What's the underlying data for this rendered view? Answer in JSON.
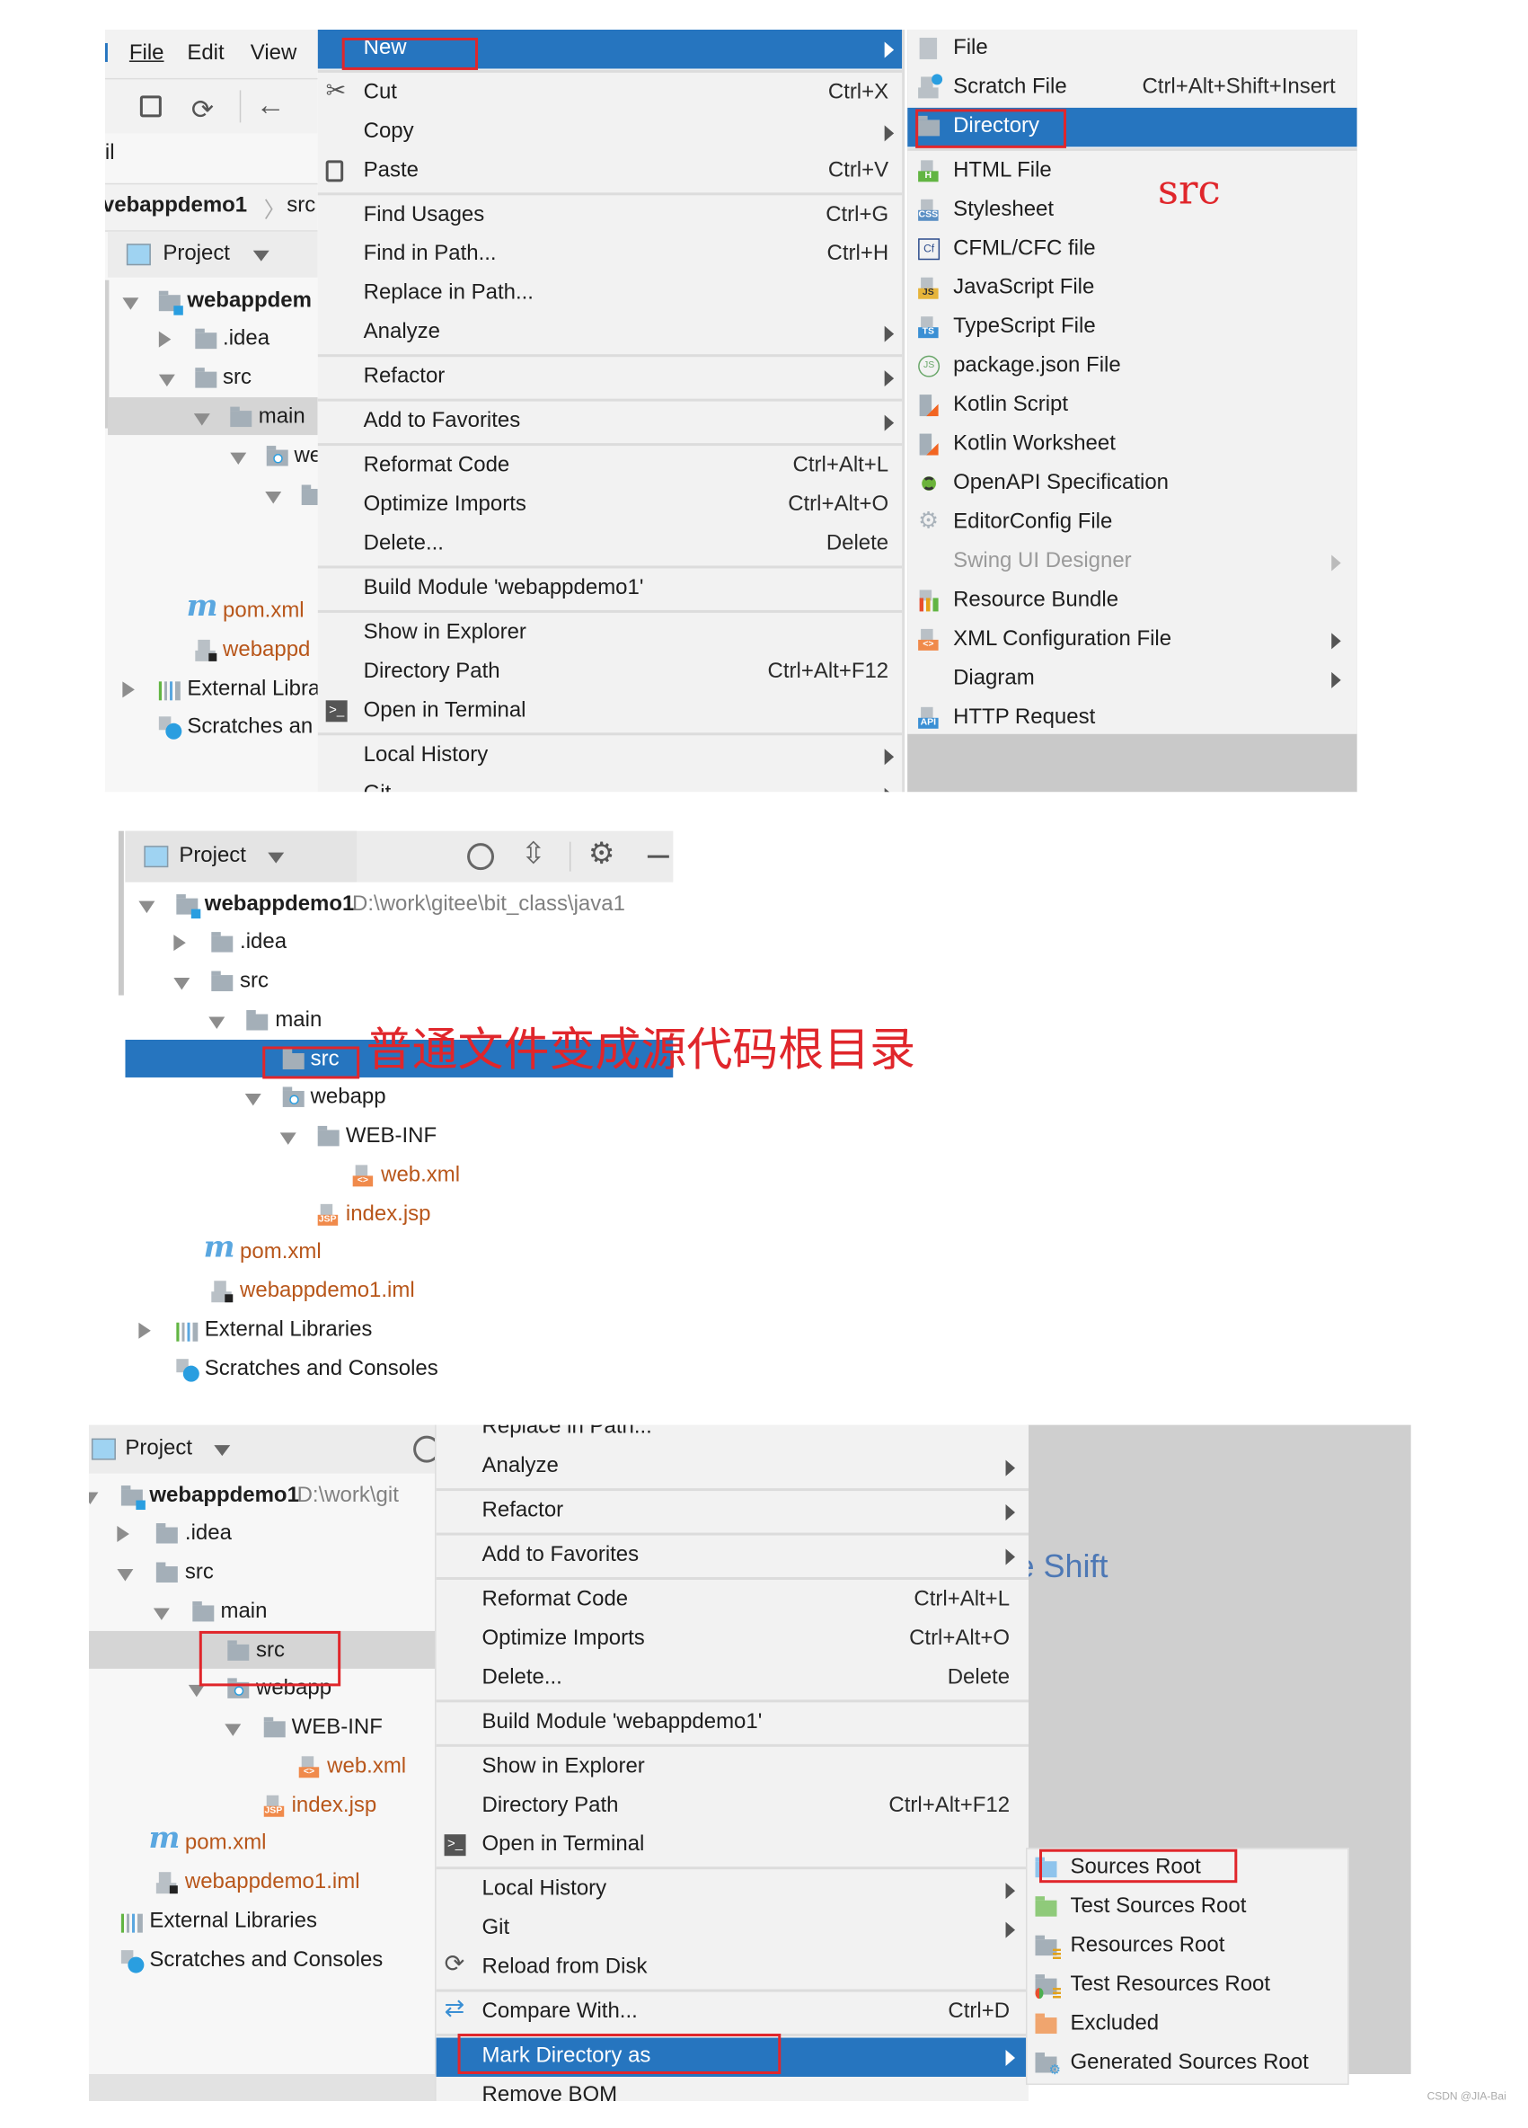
{
  "panel1": {
    "menu_bar": [
      "File",
      "Edit",
      "View"
    ],
    "toolbar_fragment": "il",
    "breadcrumb": [
      "vebappdemo1",
      "src"
    ],
    "project_label": "Project",
    "tree": [
      {
        "label": "webappdem",
        "icon": "module",
        "toggle": "exp",
        "bold": true
      },
      {
        "label": ".idea",
        "icon": "folder",
        "toggle": "col"
      },
      {
        "label": "src",
        "icon": "folder",
        "toggle": "exp"
      },
      {
        "label": "main",
        "icon": "folder",
        "toggle": "exp",
        "selected": true
      },
      {
        "label": "we",
        "icon": "web-folder",
        "toggle": "exp"
      },
      {
        "label": "",
        "icon": "folder",
        "toggle": "exp"
      },
      {
        "label": "",
        "icon": "none"
      },
      {
        "label": "",
        "icon": "jsp"
      },
      {
        "label": "pom.xml",
        "icon": "maven",
        "color": "#b8561a"
      },
      {
        "label": "webappd",
        "icon": "iml",
        "color": "#b8561a"
      },
      {
        "label": "External Libra",
        "icon": "libraries",
        "toggle": "col"
      },
      {
        "label": "Scratches an",
        "icon": "scratches"
      }
    ],
    "context_menu": [
      {
        "label": "New",
        "submenu": true,
        "highlighted": true
      },
      {
        "separator": true
      },
      {
        "label": "Cut",
        "shortcut": "Ctrl+X",
        "icon": "cut"
      },
      {
        "label": "Copy",
        "submenu": true
      },
      {
        "label": "Paste",
        "shortcut": "Ctrl+V",
        "icon": "paste"
      },
      {
        "separator": true
      },
      {
        "label": "Find Usages",
        "shortcut": "Ctrl+G"
      },
      {
        "label": "Find in Path...",
        "shortcut": "Ctrl+H"
      },
      {
        "label": "Replace in Path..."
      },
      {
        "label": "Analyze",
        "submenu": true
      },
      {
        "separator": true
      },
      {
        "label": "Refactor",
        "submenu": true
      },
      {
        "separator": true
      },
      {
        "label": "Add to Favorites",
        "submenu": true
      },
      {
        "separator": true
      },
      {
        "label": "Reformat Code",
        "shortcut": "Ctrl+Alt+L"
      },
      {
        "label": "Optimize Imports",
        "shortcut": "Ctrl+Alt+O"
      },
      {
        "label": "Delete...",
        "shortcut": "Delete"
      },
      {
        "separator": true
      },
      {
        "label": "Build Module 'webappdemo1'"
      },
      {
        "separator": true
      },
      {
        "label": "Show in Explorer"
      },
      {
        "label": "Directory Path",
        "shortcut": "Ctrl+Alt+F12"
      },
      {
        "label": "Open in Terminal",
        "icon": "terminal"
      },
      {
        "separator": true
      },
      {
        "label": "Local History",
        "submenu": true
      },
      {
        "label": "Git",
        "submenu": true
      }
    ],
    "new_submenu": [
      {
        "label": "File",
        "icon": "file"
      },
      {
        "label": "Scratch File",
        "shortcut": "Ctrl+Alt+Shift+Insert",
        "icon": "scratch"
      },
      {
        "label": "Directory",
        "icon": "folder",
        "highlighted": true
      },
      {
        "separator": true
      },
      {
        "label": "HTML File",
        "icon": "html"
      },
      {
        "label": "Stylesheet",
        "icon": "css"
      },
      {
        "label": "CFML/CFC file",
        "icon": "cfml"
      },
      {
        "label": "JavaScript File",
        "icon": "js"
      },
      {
        "label": "TypeScript File",
        "icon": "ts"
      },
      {
        "label": "package.json File",
        "icon": "npm"
      },
      {
        "label": "Kotlin Script",
        "icon": "kotlin"
      },
      {
        "label": "Kotlin Worksheet",
        "icon": "kotlin"
      },
      {
        "label": "OpenAPI Specification",
        "icon": "openapi"
      },
      {
        "label": "EditorConfig File",
        "icon": "gear"
      },
      {
        "label": "Swing UI Designer",
        "submenu": true,
        "disabled": true
      },
      {
        "label": "Resource Bundle",
        "icon": "bundle"
      },
      {
        "label": "XML Configuration File",
        "icon": "xml",
        "submenu": true
      },
      {
        "label": "Diagram",
        "submenu": true
      },
      {
        "label": "HTTP Request",
        "icon": "api"
      }
    ],
    "annotation": "src"
  },
  "panel2": {
    "project_label": "Project",
    "toolbar_icons": [
      "crosshair-icon",
      "collapse-all-icon",
      "gear-icon",
      "minimize-icon"
    ],
    "tree": [
      {
        "label": "webappdemo1",
        "icon": "module",
        "toggle": "exp",
        "bold": true,
        "path": "D:\\work\\gitee\\bit_class\\java1"
      },
      {
        "label": ".idea",
        "icon": "folder",
        "toggle": "col"
      },
      {
        "label": "src",
        "icon": "folder",
        "toggle": "exp"
      },
      {
        "label": "main",
        "icon": "folder",
        "toggle": "exp"
      },
      {
        "label": "src",
        "icon": "folder",
        "selected": true
      },
      {
        "label": "webapp",
        "icon": "web-folder",
        "toggle": "exp"
      },
      {
        "label": "WEB-INF",
        "icon": "folder",
        "toggle": "exp"
      },
      {
        "label": "web.xml",
        "icon": "xml",
        "color": "#b8561a"
      },
      {
        "label": "index.jsp",
        "icon": "jsp",
        "color": "#b8561a"
      },
      {
        "label": "pom.xml",
        "icon": "maven",
        "color": "#b8561a"
      },
      {
        "label": "webappdemo1.iml",
        "icon": "iml",
        "color": "#b8561a"
      },
      {
        "label": "External Libraries",
        "icon": "libraries",
        "toggle": "col"
      },
      {
        "label": "Scratches and Consoles",
        "icon": "scratches"
      }
    ],
    "annotation": "普通文件变成源代码根目录"
  },
  "panel3": {
    "project_label": "Project",
    "tree": [
      {
        "label": "webappdemo1",
        "icon": "module",
        "toggle": "exp",
        "bold": true,
        "path": "D:\\work\\git"
      },
      {
        "label": ".idea",
        "icon": "folder",
        "toggle": "col"
      },
      {
        "label": "src",
        "icon": "folder",
        "toggle": "exp"
      },
      {
        "label": "main",
        "icon": "folder",
        "toggle": "exp"
      },
      {
        "label": "src",
        "icon": "folder",
        "selected": true
      },
      {
        "label": "webapp",
        "icon": "web-folder",
        "toggle": "exp"
      },
      {
        "label": "WEB-INF",
        "icon": "folder",
        "toggle": "exp"
      },
      {
        "label": "web.xml",
        "icon": "xml",
        "color": "#b8561a"
      },
      {
        "label": "index.jsp",
        "icon": "jsp",
        "color": "#b8561a"
      },
      {
        "label": "pom.xml",
        "icon": "maven",
        "color": "#b8561a"
      },
      {
        "label": "webappdemo1.iml",
        "icon": "iml",
        "color": "#b8561a"
      },
      {
        "label": "External Libraries",
        "icon": "libraries"
      },
      {
        "label": "Scratches and Consoles",
        "icon": "scratches"
      }
    ],
    "context_menu": [
      {
        "label": "Replace in Path..."
      },
      {
        "label": "Analyze",
        "submenu": true
      },
      {
        "separator": true
      },
      {
        "label": "Refactor",
        "submenu": true
      },
      {
        "separator": true
      },
      {
        "label": "Add to Favorites",
        "submenu": true
      },
      {
        "separator": true
      },
      {
        "label": "Reformat Code",
        "shortcut": "Ctrl+Alt+L"
      },
      {
        "label": "Optimize Imports",
        "shortcut": "Ctrl+Alt+O"
      },
      {
        "label": "Delete...",
        "shortcut": "Delete"
      },
      {
        "separator": true
      },
      {
        "label": "Build Module 'webappdemo1'"
      },
      {
        "separator": true
      },
      {
        "label": "Show in Explorer"
      },
      {
        "label": "Directory Path",
        "shortcut": "Ctrl+Alt+F12"
      },
      {
        "label": "Open in Terminal",
        "icon": "terminal"
      },
      {
        "separator": true
      },
      {
        "label": "Local History",
        "submenu": true
      },
      {
        "label": "Git",
        "submenu": true
      },
      {
        "label": "Reload from Disk",
        "icon": "reload"
      },
      {
        "separator": true
      },
      {
        "label": "Compare With...",
        "shortcut": "Ctrl+D",
        "icon": "compare"
      },
      {
        "separator": true
      },
      {
        "label": "Mark Directory as",
        "submenu": true,
        "highlighted": true
      },
      {
        "label": "Remove BOM"
      }
    ],
    "mark_submenu": [
      {
        "label": "Sources Root",
        "icon": "folder-blue"
      },
      {
        "label": "Test Sources Root",
        "icon": "folder-green"
      },
      {
        "label": "Resources Root",
        "icon": "resources"
      },
      {
        "label": "Test Resources Root",
        "icon": "test-resources"
      },
      {
        "label": "Excluded",
        "icon": "folder-orange"
      },
      {
        "label": "Generated Sources Root",
        "icon": "generated"
      }
    ],
    "background_hint": "e Shift"
  },
  "watermark": "CSDN @JIA-Bai",
  "colors": {
    "selection": "#2675bf",
    "menu_bg": "#f2f2f2",
    "annotation_red": "#e0262b",
    "unversioned_file": "#b8561a"
  }
}
